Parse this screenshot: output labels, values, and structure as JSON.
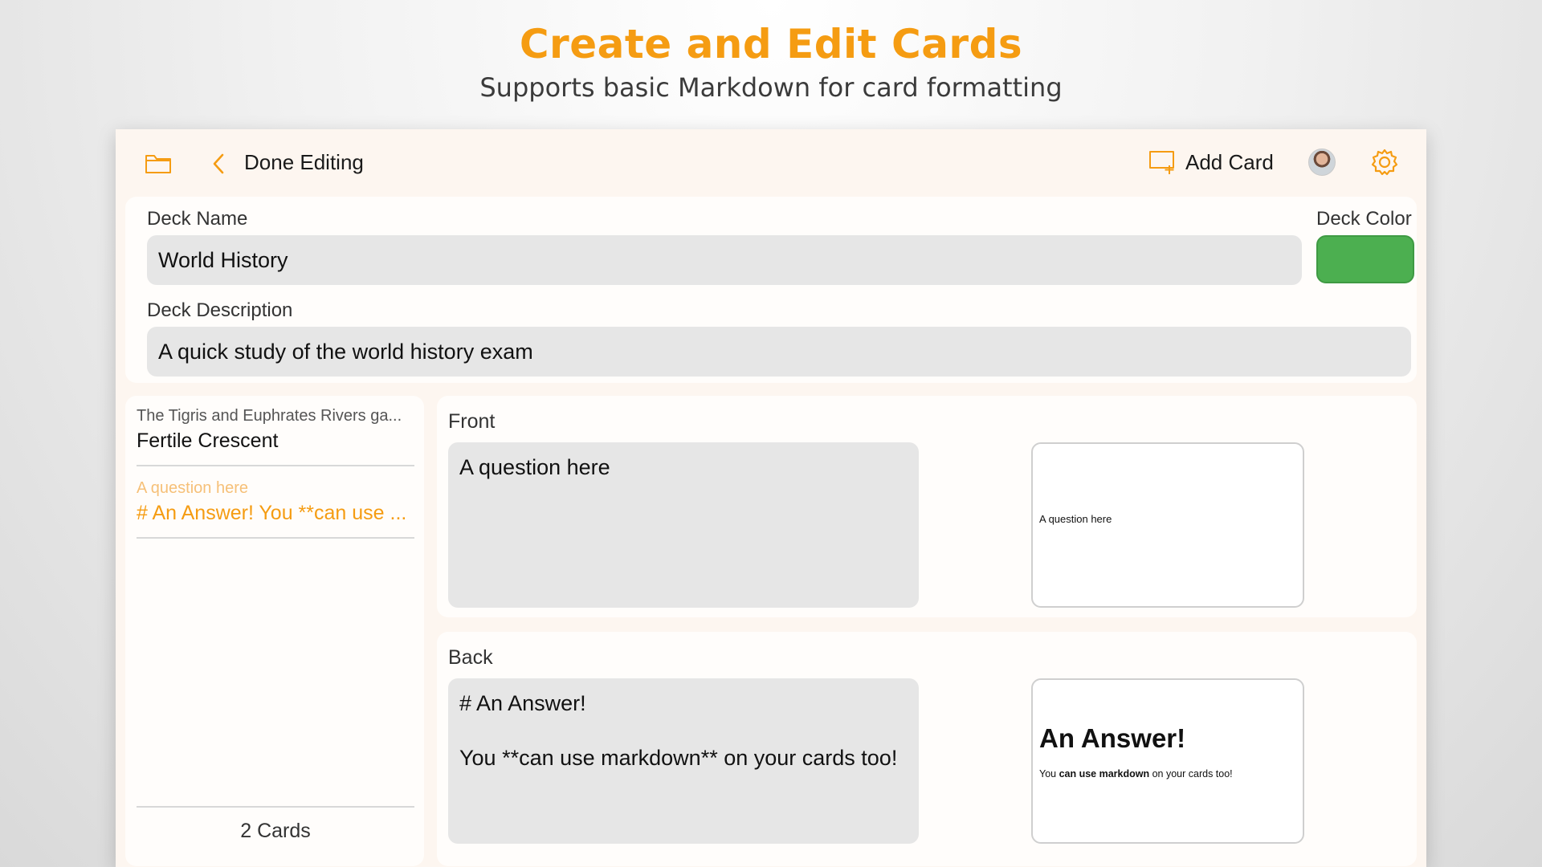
{
  "promo": {
    "title": "Create and Edit Cards",
    "subtitle": "Supports basic Markdown for card formatting"
  },
  "toolbar": {
    "folder_icon": "folder-icon",
    "back_icon": "chevron-left-icon",
    "done_label": "Done Editing",
    "add_card_icon": "add-card-icon",
    "add_card_label": "Add Card",
    "avatar": "avatar",
    "settings_icon": "gear-icon"
  },
  "deck": {
    "name_label": "Deck Name",
    "name_value": "World History",
    "color_label": "Deck Color",
    "color_value": "#4caf50",
    "description_label": "Deck Description",
    "description_value": "A quick study of the world history exam"
  },
  "card_list": {
    "items": [
      {
        "front": "The Tigris and Euphrates Rivers ga...",
        "back": "Fertile Crescent",
        "selected": false
      },
      {
        "front": "A question here",
        "back": "# An Answer! You **can use ...",
        "selected": true
      }
    ],
    "count_label": "2 Cards"
  },
  "editor": {
    "front_label": "Front",
    "front_value": "A question here",
    "front_preview": "A question here",
    "back_label": "Back",
    "back_value": "# An Answer!\n\nYou **can use markdown** on your cards too!",
    "back_preview_heading": "An Answer!",
    "back_preview_parts": [
      "You ",
      "can use markdown",
      " on your cards too!"
    ]
  },
  "colors": {
    "accent": "#f59c12",
    "deck_color": "#4caf50",
    "panel_bg": "#fffdfb",
    "input_bg": "#e6e6e6"
  }
}
